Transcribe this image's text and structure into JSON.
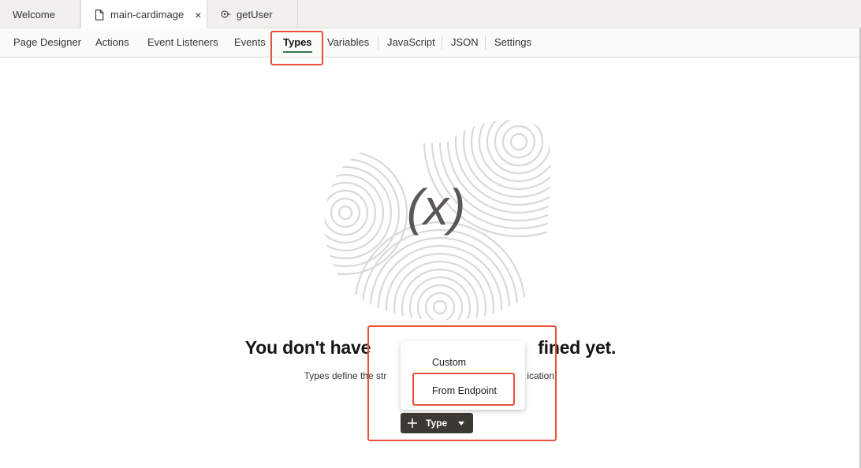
{
  "file_tabs": [
    {
      "label": "Welcome",
      "icon": "none"
    },
    {
      "label": "main-cardimage",
      "icon": "page-icon",
      "closable": true,
      "close_glyph": "×",
      "active": true
    },
    {
      "label": "getUser",
      "icon": "service-connection-icon"
    }
  ],
  "editor_tabs": [
    {
      "label": "Page Designer"
    },
    {
      "label": "Actions"
    },
    {
      "label": "Event Listeners"
    },
    {
      "label": "Events"
    },
    {
      "label": "Types",
      "active": true
    },
    {
      "label": "Variables"
    },
    {
      "label": "JavaScript"
    },
    {
      "label": "JSON"
    },
    {
      "label": "Settings"
    }
  ],
  "empty_state": {
    "illustration_text": "(x)",
    "title_left": "You don't have",
    "title_right": "fined yet.",
    "desc_left": "Types define the str",
    "desc_right": "ication."
  },
  "add_button": {
    "label": "Type",
    "icon": "plus-icon",
    "caret": "chevron-down-icon"
  },
  "dropdown_menu": {
    "items": [
      "Custom",
      "From Endpoint"
    ],
    "highlighted": "From Endpoint"
  },
  "colors": {
    "highlight": "#e8503a",
    "active_tab_underline": "#3a7a4e",
    "button_bg": "#3c3935"
  }
}
